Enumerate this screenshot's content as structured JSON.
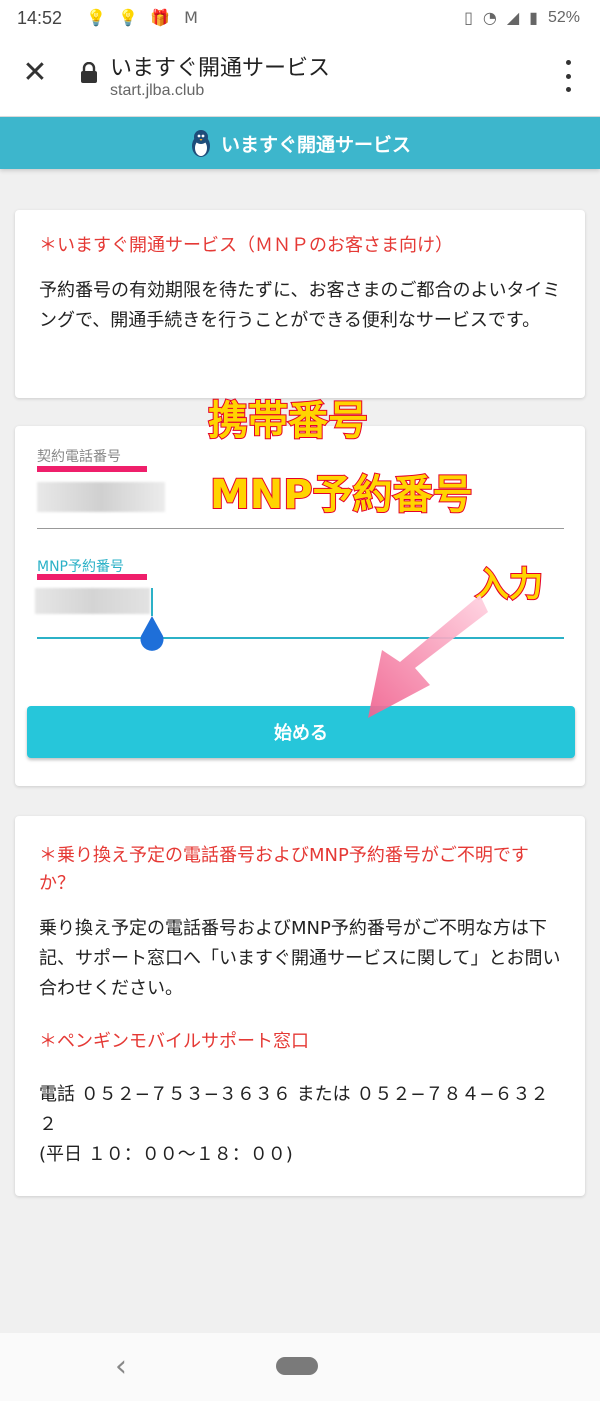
{
  "status_bar": {
    "time": "14:52",
    "notification_icons": [
      "lightbulb-icon",
      "lightbulb-icon",
      "gift-icon",
      "gmail-icon"
    ],
    "status_icons": [
      "vibrate-icon",
      "wifi-icon",
      "signal-icon",
      "battery-icon"
    ],
    "battery": "52%"
  },
  "browser": {
    "page_title": "いますぐ開通サービス",
    "url": "start.jlba.club"
  },
  "header": {
    "title": "いますぐ開通サービス",
    "bg_color": "#3db6cc"
  },
  "intro": {
    "title": "＊いますぐ開通サービス（ＭＮＰのお客さま向け）",
    "body": "予約番号の有効期限を待たずに、お客さまのご都合のよいタイミングで、開通手続きを行うことができる便利なサービスです。"
  },
  "form": {
    "phone_label": "契約電話番号",
    "mnp_label": "MNP予約番号",
    "start_button": "始める",
    "button_color": "#26c6da"
  },
  "overlay": {
    "line1": "携帯番号",
    "line2": "MNP予約番号",
    "input_note": "入力",
    "highlight_color": "#ef1f6b"
  },
  "help": {
    "title": "＊乗り換え予定の電話番号およびMNP予約番号がご不明ですか？",
    "body": "乗り換え予定の電話番号およびMNP予約番号がご不明な方は下記、サポート窓口へ「いますぐ開通サービスに関して」とお問い合わせください。",
    "support_title": "＊ペンギンモバイルサポート窓口",
    "phone_line": "電話 ０５２−７５３−３６３６ または ０５２−７８４−６３２２",
    "hours": "(平日 １０：００〜１８：００)"
  }
}
